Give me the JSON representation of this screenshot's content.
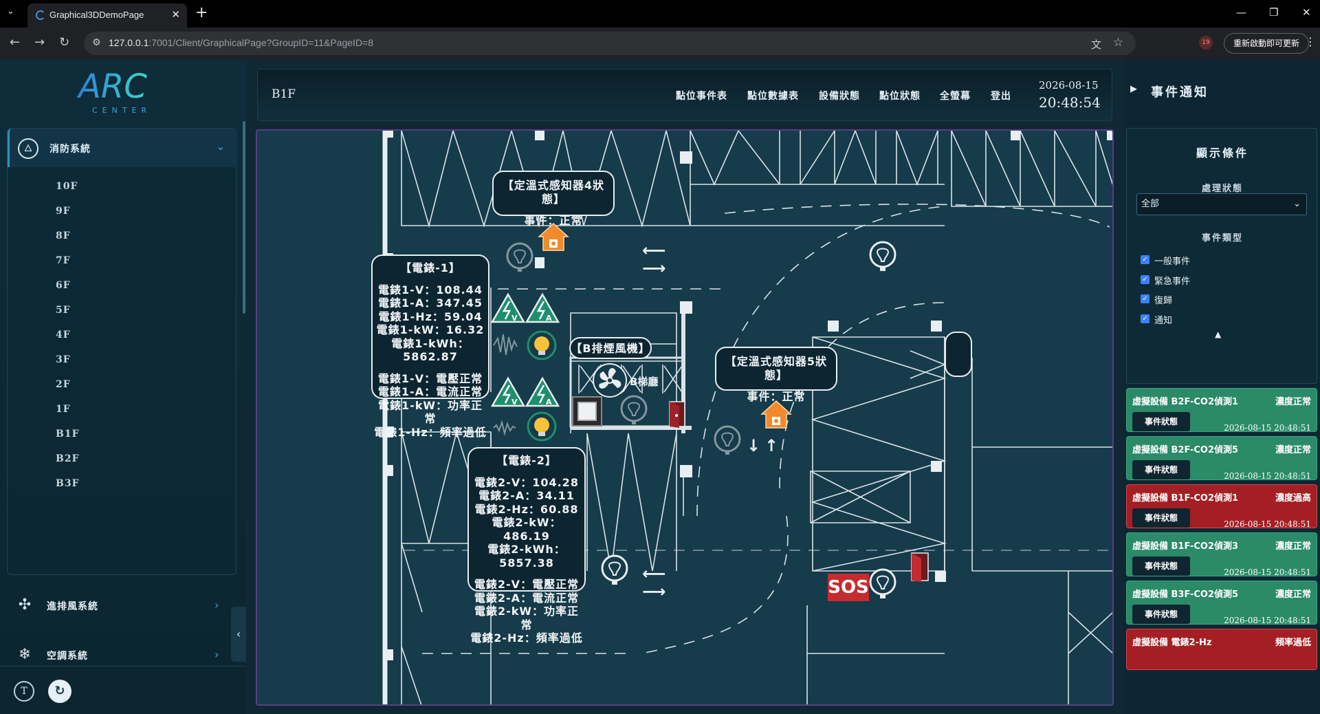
{
  "browser": {
    "tab_title": "Graphical3DDemoPage",
    "url_host": "127.0.0.1",
    "url_rest": ":7001/Client/GraphicalPage?GroupID=11&PageID=8",
    "update_label": "重新啟動即可更新",
    "profile_initial": "19"
  },
  "sidebar": {
    "logo_text": "ARC",
    "logo_sub": "CENTER",
    "fire_label": "消防系統",
    "floors": [
      "10F",
      "9F",
      "8F",
      "7F",
      "6F",
      "5F",
      "4F",
      "3F",
      "2F",
      "1F",
      "B1F",
      "B2F",
      "B3F"
    ],
    "ventilation_label": "進排風系統",
    "aircon_label": "空調系統",
    "t_label": "T"
  },
  "header": {
    "floor_title": "B1F",
    "nav": [
      "點位事件表",
      "點位數據表",
      "設備狀態",
      "點位狀態",
      "全螢幕",
      "登出"
    ],
    "date": "2026-08-15",
    "time": "20:48:54"
  },
  "map": {
    "sensor4": {
      "title": "【定溫式感知器4狀態】",
      "line": "事件：正常"
    },
    "sensor5": {
      "title": "【定溫式感知器5狀態】",
      "line": "事件：正常"
    },
    "fan": {
      "title": "【B排煙風機】"
    },
    "elevator_label": "B梯廳",
    "sos_label": "SOS",
    "meter1": {
      "title": "【電錶-1】",
      "lines": [
        "電錶1-V：108.44",
        "電錶1-A：347.45",
        "電錶1-Hz：59.04",
        "電錶1-kW：16.32",
        "電錶1-kWh：5862.87"
      ],
      "status": [
        "電錶1-V：電壓正常",
        "電錶1-A：電流正常",
        "電錶1-kW：功率正常",
        "電錶1-Hz：頻率過低"
      ]
    },
    "meter2": {
      "title": "【電錶-2】",
      "lines": [
        "電錶2-V：104.28",
        "電錶2-A：34.11",
        "電錶2-Hz：60.88",
        "電錶2-kW：486.19",
        "電錶2-kWh：5857.38"
      ],
      "status": [
        "電錶2-V：電壓正常",
        "電錶2-A：電流正常",
        "電錶2-kW：功率正常",
        "電錶2-Hz：頻率過低"
      ]
    },
    "meter_letters": [
      "V",
      "A"
    ]
  },
  "notifications": {
    "title": "事件通知",
    "filter_title": "顯示條件",
    "status_label": "處理狀態",
    "status_value": "全部",
    "type_label": "事件類型",
    "types": [
      "一般事件",
      "緊急事件",
      "復歸",
      "通知"
    ],
    "events": [
      {
        "name": "虛擬設備 B2F-CO2偵測1",
        "state": "濃度正常",
        "button": "事件狀態",
        "time": "2026-08-15 20:48:51",
        "level": "normal"
      },
      {
        "name": "虛擬設備 B2F-CO2偵測5",
        "state": "濃度正常",
        "button": "事件狀態",
        "time": "2026-08-15 20:48:51",
        "level": "normal"
      },
      {
        "name": "虛擬設備 B1F-CO2偵測1",
        "state": "濃度過高",
        "button": "事件狀態",
        "time": "2026-08-15 20:48:51",
        "level": "alarm"
      },
      {
        "name": "虛擬設備 B1F-CO2偵測3",
        "state": "濃度正常",
        "button": "事件狀態",
        "time": "2026-08-15 20:48:51",
        "level": "normal"
      },
      {
        "name": "虛擬設備 B3F-CO2偵測5",
        "state": "濃度正常",
        "button": "事件狀態",
        "time": "2026-08-15 20:48:51",
        "level": "normal"
      },
      {
        "name": "虛擬設備 電錶2-Hz",
        "state": "頻率過低",
        "button": "",
        "time": "",
        "level": "alarm"
      }
    ]
  },
  "colors": {
    "normal": "#2b8a68",
    "alarm": "#a41f23",
    "house": "#f08a2c",
    "meter_icon": "#1e8f6c"
  }
}
